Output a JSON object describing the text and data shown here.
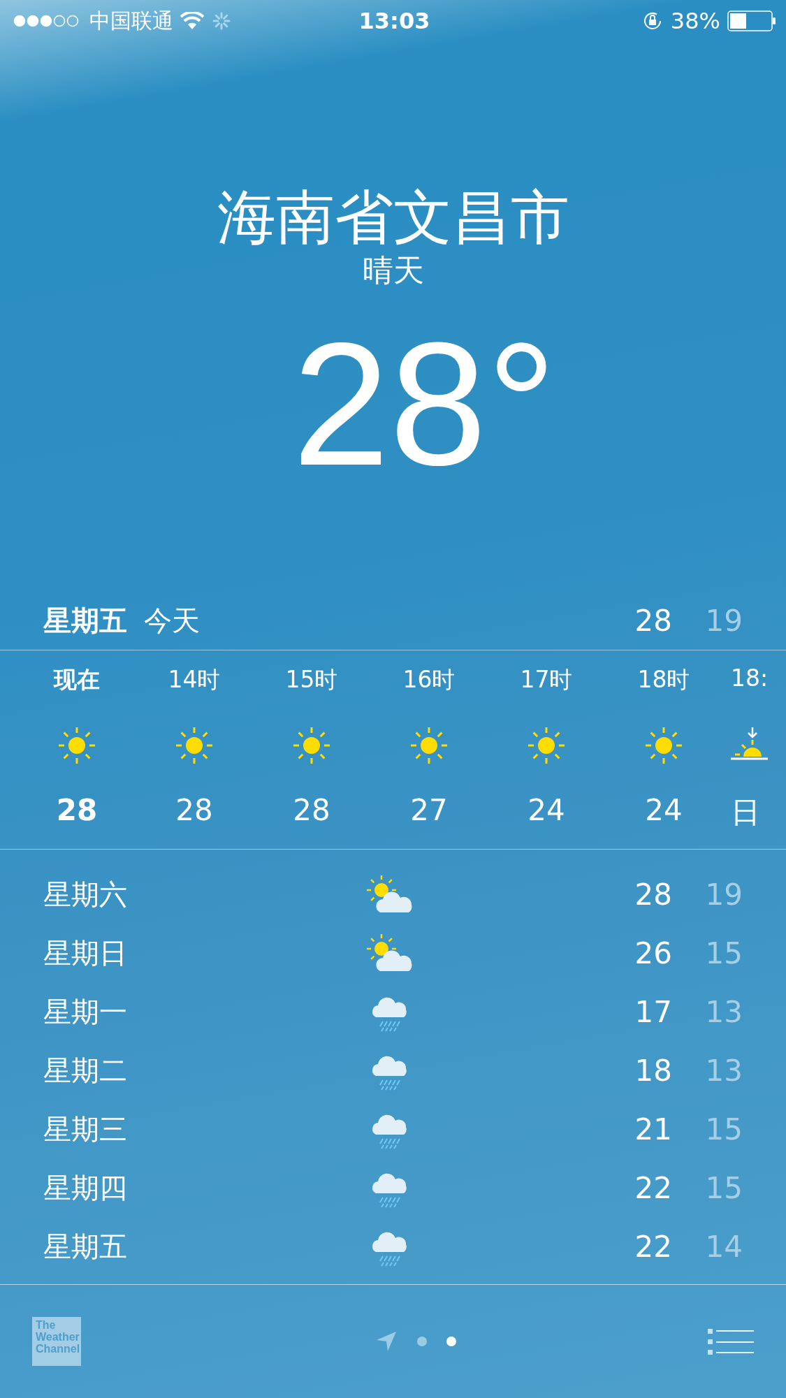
{
  "status_bar": {
    "carrier": "中国联通",
    "time": "13:03",
    "battery": "38%"
  },
  "location": {
    "city": "海南省文昌市",
    "condition": "晴天",
    "temperature": "28°"
  },
  "today": {
    "day": "星期五",
    "label": "今天",
    "high": "28",
    "low": "19"
  },
  "hourly": [
    {
      "time": "现在",
      "kind": "sun",
      "temp": "28",
      "current": true
    },
    {
      "time": "14时",
      "kind": "sun",
      "temp": "28",
      "current": false
    },
    {
      "time": "15时",
      "kind": "sun",
      "temp": "28",
      "current": false
    },
    {
      "time": "16时",
      "kind": "sun",
      "temp": "27",
      "current": false
    },
    {
      "time": "17时",
      "kind": "sun",
      "temp": "24",
      "current": false
    },
    {
      "time": "18时",
      "kind": "sun",
      "temp": "24",
      "current": false
    },
    {
      "time": "18:",
      "kind": "sunset",
      "temp": "日",
      "current": false
    }
  ],
  "daily": [
    {
      "day": "星期六",
      "kind": "sun-cloud",
      "high": "28",
      "low": "19"
    },
    {
      "day": "星期日",
      "kind": "sun-cloud",
      "high": "26",
      "low": "15"
    },
    {
      "day": "星期一",
      "kind": "rain",
      "high": "17",
      "low": "13"
    },
    {
      "day": "星期二",
      "kind": "rain",
      "high": "18",
      "low": "13"
    },
    {
      "day": "星期三",
      "kind": "rain",
      "high": "21",
      "low": "15"
    },
    {
      "day": "星期四",
      "kind": "rain",
      "high": "22",
      "low": "15"
    },
    {
      "day": "星期五",
      "kind": "rain",
      "high": "22",
      "low": "14"
    }
  ],
  "footer": {
    "logo": "The Weather Channel",
    "pages": [
      {
        "selected": false
      },
      {
        "selected": true
      }
    ]
  }
}
